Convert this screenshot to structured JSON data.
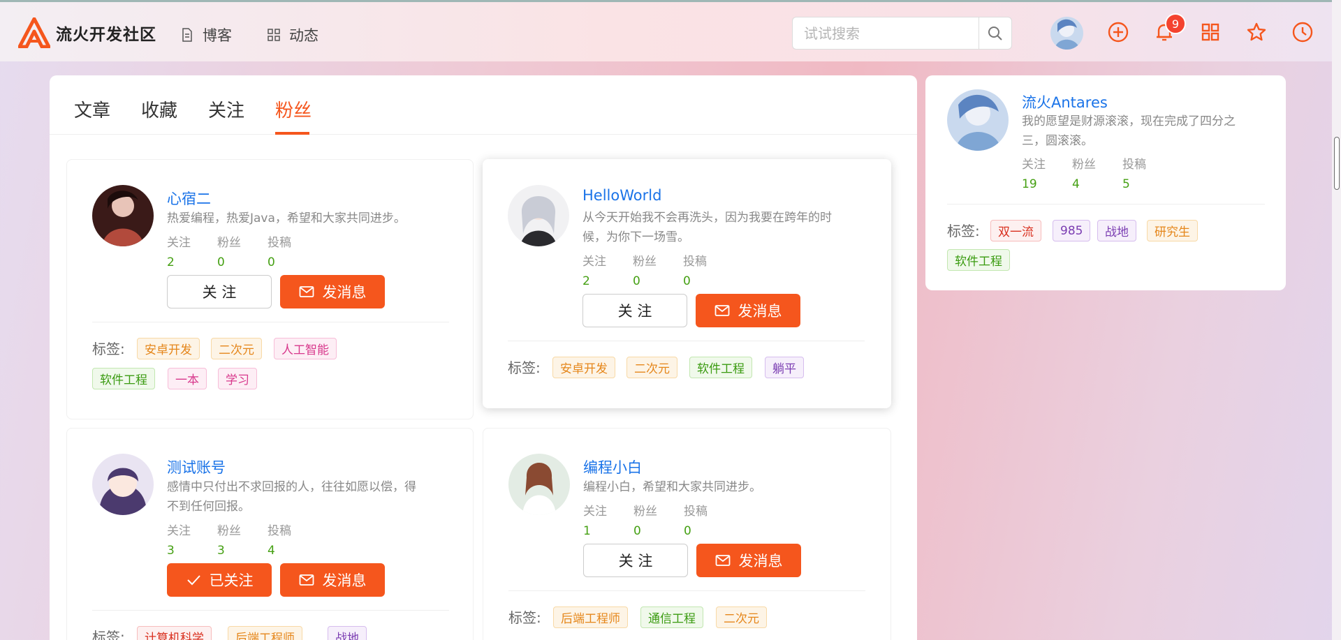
{
  "header": {
    "site_name": "流火开发社区",
    "nav": [
      {
        "label": "博客",
        "icon": "document-icon"
      },
      {
        "label": "动态",
        "icon": "grid-icon"
      }
    ],
    "search_placeholder": "试试搜索",
    "notification_count": "9",
    "accent_color": "#f5561d"
  },
  "tabs": [
    {
      "label": "文章",
      "active": false
    },
    {
      "label": "收藏",
      "active": false
    },
    {
      "label": "关注",
      "active": false
    },
    {
      "label": "粉丝",
      "active": true
    }
  ],
  "labels": {
    "following": "关注",
    "fans": "粉丝",
    "posts": "投稿",
    "tags": "标签:",
    "follow_btn": "关 注",
    "followed_btn": "已关注",
    "message_btn": "发消息"
  },
  "fans": [
    {
      "name": "心宿二",
      "desc": "热爱编程，热爱Java，希望和大家共同进步。",
      "following": "2",
      "fans": "0",
      "posts": "0",
      "followed": false,
      "tags": [
        {
          "text": "安卓开发",
          "color": "orange"
        },
        {
          "text": "二次元",
          "color": "orange"
        },
        {
          "text": "人工智能",
          "color": "pink"
        },
        {
          "text": "软件工程",
          "color": "green"
        },
        {
          "text": "一本",
          "color": "pink"
        },
        {
          "text": "学习",
          "color": "pink"
        }
      ]
    },
    {
      "name": "HelloWorld",
      "desc": "从今天开始我不会再洗头，因为我要在跨年的时候，为你下一场雪。",
      "following": "2",
      "fans": "0",
      "posts": "0",
      "followed": false,
      "tags": [
        {
          "text": "安卓开发",
          "color": "orange"
        },
        {
          "text": "二次元",
          "color": "orange"
        },
        {
          "text": "软件工程",
          "color": "green"
        },
        {
          "text": "躺平",
          "color": "purple"
        }
      ]
    },
    {
      "name": "测试账号",
      "desc": "感情中只付出不求回报的人，往往如愿以偿，得不到任何回报。",
      "following": "3",
      "fans": "3",
      "posts": "4",
      "followed": true,
      "tags": [
        {
          "text": "计算机科学",
          "color": "red"
        },
        {
          "text": "后端工程师",
          "color": "orange"
        },
        {
          "text": "战地",
          "color": "purple"
        }
      ]
    },
    {
      "name": "编程小白",
      "desc": "编程小白，希望和大家共同进步。",
      "following": "1",
      "fans": "0",
      "posts": "0",
      "followed": false,
      "tags": [
        {
          "text": "后端工程师",
          "color": "orange"
        },
        {
          "text": "通信工程",
          "color": "green"
        },
        {
          "text": "二次元",
          "color": "orange"
        }
      ]
    }
  ],
  "profile": {
    "name": "流火Antares",
    "desc": "我的愿望是财源滚滚，现在完成了四分之三，圆滚滚。",
    "following": "19",
    "fans": "4",
    "posts": "5",
    "tags": [
      {
        "text": "双一流",
        "color": "red"
      },
      {
        "text": "985",
        "color": "purple"
      },
      {
        "text": "战地",
        "color": "purple"
      },
      {
        "text": "研究生",
        "color": "orange"
      },
      {
        "text": "软件工程",
        "color": "green"
      }
    ]
  }
}
